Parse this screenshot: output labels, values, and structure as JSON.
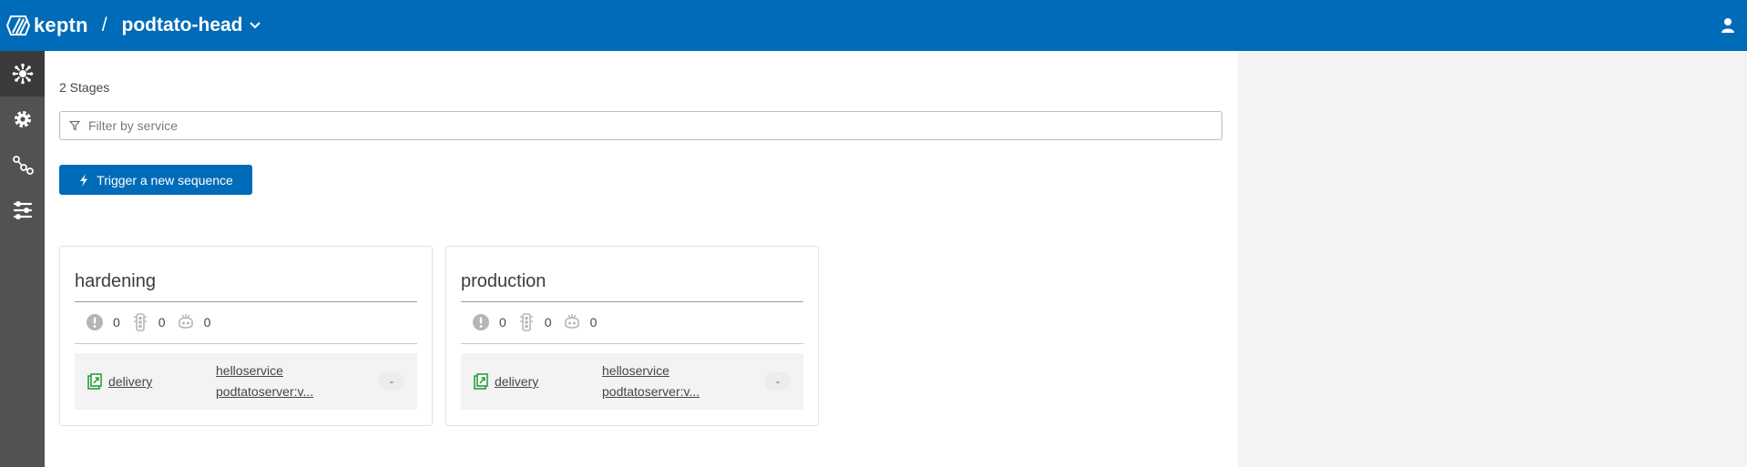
{
  "header": {
    "logo_text": "keptn",
    "separator": "/",
    "project_name": "podtato-head"
  },
  "sidebar": {
    "items": [
      {
        "name": "environment",
        "icon": "environment-icon",
        "active": true
      },
      {
        "name": "settings",
        "icon": "gear-icon",
        "active": false
      },
      {
        "name": "sequences",
        "icon": "sequence-icon",
        "active": false
      },
      {
        "name": "services",
        "icon": "sliders-icon",
        "active": false
      }
    ]
  },
  "main": {
    "stage_count": "2 Stages",
    "filter_placeholder": "Filter by service",
    "trigger_label": "Trigger a new sequence"
  },
  "stages": [
    {
      "name": "hardening",
      "counters": {
        "problems": "0",
        "evaluations": "0",
        "remediations": "0"
      },
      "services": [
        {
          "name": "delivery",
          "artifact_line1": "helloservice",
          "artifact_line2": "podtatoserver:v...",
          "badge": "-"
        }
      ]
    },
    {
      "name": "production",
      "counters": {
        "problems": "0",
        "evaluations": "0",
        "remediations": "0"
      },
      "services": [
        {
          "name": "delivery",
          "artifact_line1": "helloservice",
          "artifact_line2": "podtatoserver:v...",
          "badge": "-"
        }
      ]
    }
  ],
  "colors": {
    "brand": "#006bb8",
    "sidebar": "#525252",
    "sidebar_active": "#3a3a3a",
    "service_green": "#2e9a3d",
    "muted_icon": "#b5b5b5"
  }
}
